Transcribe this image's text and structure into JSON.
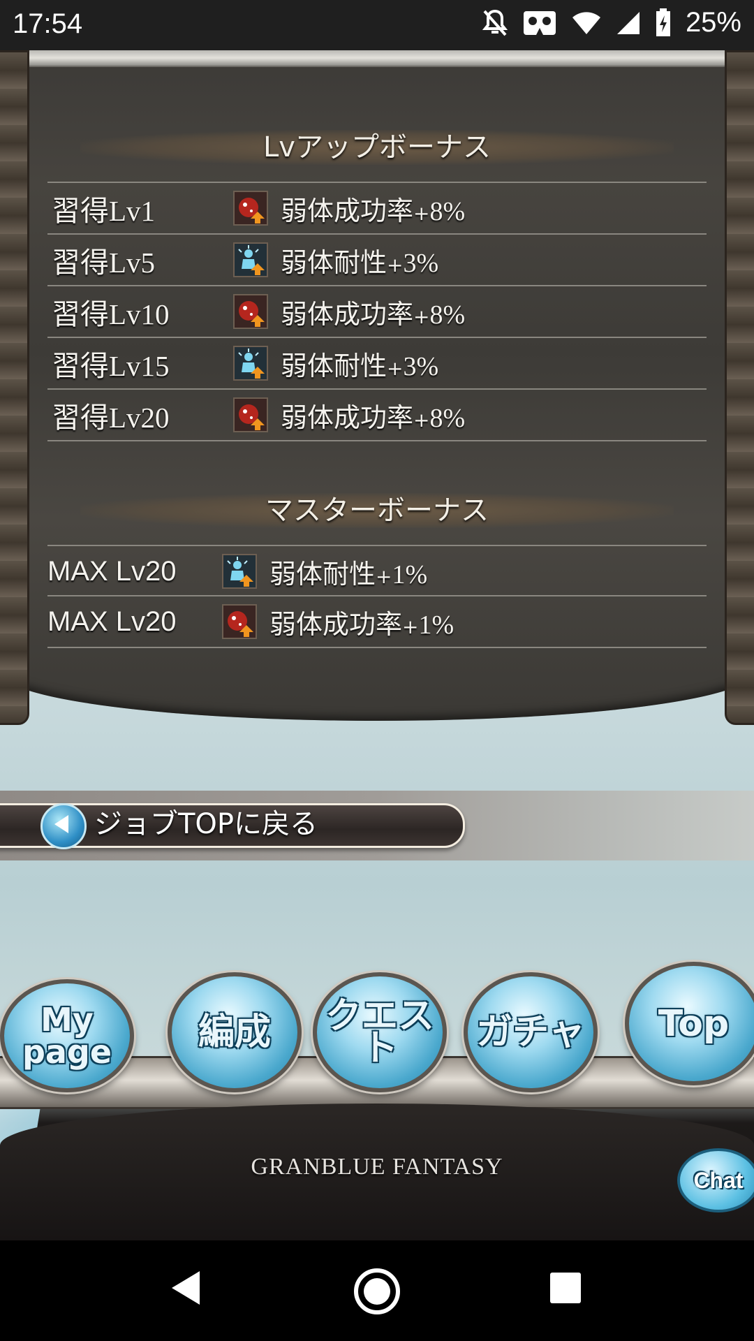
{
  "status_bar": {
    "time": "17:54",
    "battery": "25%",
    "icons": [
      "notifications-off-icon",
      "vr-icon",
      "wifi-icon",
      "signal-icon",
      "battery-charging-icon"
    ]
  },
  "panel": {
    "lv_section": {
      "title": "Lvアップボーナス",
      "rows": [
        {
          "level": "習得Lv1",
          "icon": "debuff-success-icon",
          "name": "弱体成功率",
          "plus": "+",
          "value": "8%"
        },
        {
          "level": "習得Lv5",
          "icon": "debuff-resistance-icon",
          "name": "弱体耐性",
          "plus": "+",
          "value": "3%"
        },
        {
          "level": "習得Lv10",
          "icon": "debuff-success-icon",
          "name": "弱体成功率",
          "plus": "+",
          "value": "8%"
        },
        {
          "level": "習得Lv15",
          "icon": "debuff-resistance-icon",
          "name": "弱体耐性",
          "plus": "+",
          "value": "3%"
        },
        {
          "level": "習得Lv20",
          "icon": "debuff-success-icon",
          "name": "弱体成功率",
          "plus": "+",
          "value": "8%"
        }
      ]
    },
    "master_section": {
      "title": "マスターボーナス",
      "rows": [
        {
          "level": "MAX Lv20",
          "icon": "debuff-resistance-icon",
          "name": "弱体耐性",
          "plus": "+",
          "value": "1%"
        },
        {
          "level": "MAX Lv20",
          "icon": "debuff-success-icon",
          "name": "弱体成功率",
          "plus": "+",
          "value": "1%"
        }
      ]
    }
  },
  "back_button": {
    "label": "ジョブTOPに戻る"
  },
  "bottom_nav": {
    "mypage_line1": "My",
    "mypage_line2": "page",
    "formation": "編成",
    "quest": "クエスト",
    "gacha": "ガチャ",
    "top": "Top",
    "chat": "Chat",
    "logo": "GRANBLUE FANTASY"
  },
  "colors": {
    "panel_bg": "#3f3c38",
    "bubble_blue": "#4aa8cd",
    "divider": "#8a8780"
  }
}
